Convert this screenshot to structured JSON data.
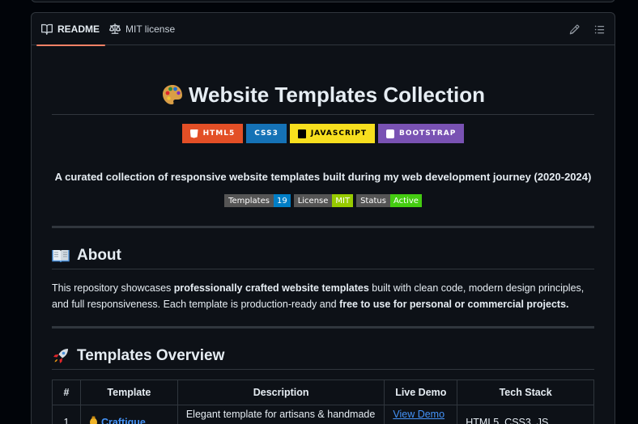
{
  "tabs": [
    {
      "label": "README",
      "icon": "book-icon",
      "active": true
    },
    {
      "label": "MIT license",
      "icon": "scale-icon",
      "active": false
    }
  ],
  "title": {
    "text": "Website Templates Collection",
    "emoji": "palette-icon"
  },
  "badges": [
    {
      "label": "HTML5",
      "color": "#e34f26",
      "icon": "html5-icon"
    },
    {
      "label": "CSS3",
      "color": "#1572b6",
      "icon": ""
    },
    {
      "label": "JAVASCRIPT",
      "color": "#f7df1e",
      "icon": "javascript-icon"
    },
    {
      "label": "BOOTSTRAP",
      "color": "#7952b3",
      "icon": "bootstrap-icon"
    }
  ],
  "tagline": "A curated collection of responsive website templates built during my web development journey (2020-2024)",
  "shields": [
    {
      "key": "Templates",
      "value": "19",
      "color": "#007ec6"
    },
    {
      "key": "License",
      "value": "MIT",
      "color": "#97ca00"
    },
    {
      "key": "Status",
      "value": "Active",
      "color": "#4c1"
    }
  ],
  "about": {
    "heading": "About",
    "emoji": "open-book-icon",
    "p1": "This repository showcases ",
    "p2": "professionally crafted website templates",
    "p3": " built with clean code, modern design principles, and full responsiveness. Each template is production-ready and ",
    "p4": "free to use for personal or commercial projects.",
    "p5": ""
  },
  "overview": {
    "heading": "Templates Overview",
    "emoji": "rocket-icon"
  },
  "table": {
    "headers": [
      "#",
      "Template",
      "Description",
      "Live Demo",
      "Tech Stack"
    ],
    "rows": [
      {
        "num": "1",
        "name": "Craftique",
        "description": "Elegant template for artisans & handmade products",
        "demo": "View Demo →",
        "tech": "HTML5, CSS3, JS"
      }
    ]
  },
  "colors": {
    "accent": "#f78166",
    "link": "#4493f8",
    "border": "#30363d",
    "bg": "#0d1117"
  }
}
